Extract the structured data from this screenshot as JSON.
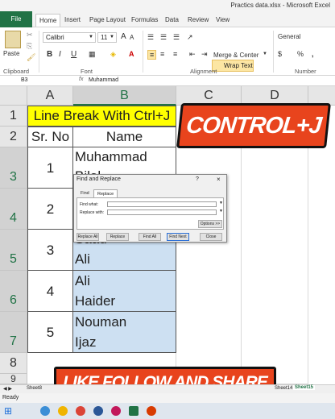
{
  "window": {
    "title": "Practics data.xlsx - Microsoft Excel"
  },
  "ribbon_tabs": [
    "File",
    "Home",
    "Insert",
    "Page Layout",
    "Formulas",
    "Data",
    "Review",
    "View"
  ],
  "ribbon": {
    "paste_label": "Paste",
    "font_name": "Calibri",
    "font_size": "11",
    "wrap_text": "Wrap Text",
    "merge_center": "Merge & Center",
    "number_format": "General",
    "bold": "B",
    "italic": "I",
    "underline": "U",
    "groups": {
      "clipboard": "Clipboard",
      "font": "Font",
      "alignment": "Alignment",
      "number": "Number"
    },
    "pct": "%",
    "currency": "$",
    "comma": ","
  },
  "formula_bar": {
    "name_box": "B3",
    "fx": "fx",
    "value": "Muhammad"
  },
  "columns": [
    "A",
    "B",
    "C",
    "D"
  ],
  "rows": [
    "1",
    "2",
    "3",
    "4",
    "5",
    "6",
    "7",
    "8",
    "9"
  ],
  "table": {
    "title": "Line Break With Ctrl+J",
    "headers": [
      "Sr. No",
      "Name"
    ],
    "records": [
      {
        "sr": "1",
        "lines": [
          "Muhammad",
          "Bilal"
        ]
      },
      {
        "sr": "2",
        "lines": [
          "",
          ""
        ]
      },
      {
        "sr": "3",
        "lines": [
          "Saad",
          "Ali"
        ]
      },
      {
        "sr": "4",
        "lines": [
          "Ali",
          "Haider"
        ]
      },
      {
        "sr": "5",
        "lines": [
          "Nouman",
          "Ijaz"
        ]
      }
    ]
  },
  "overlay": {
    "top": "CONTROL+J",
    "bottom": "LIKE FOLLOW AND SHARE"
  },
  "dialog": {
    "title": "Find and Replace",
    "help": "?",
    "close_x": "×",
    "tabs": [
      "Find",
      "Replace"
    ],
    "find_label": "Find what:",
    "replace_label": "Replace with:",
    "options": "Options >>",
    "buttons": [
      "Replace All",
      "Replace",
      "Find All",
      "Find Next",
      "Close"
    ]
  },
  "sheet_tabs": [
    "Sheet8",
    "Sheet14",
    "Sheet15"
  ],
  "status": {
    "text": "Ready"
  },
  "colors": {
    "excel_green": "#217346",
    "accent_orange": "#e8441d",
    "title_yellow": "#ffff00",
    "selection_blue": "#cde0f2"
  }
}
